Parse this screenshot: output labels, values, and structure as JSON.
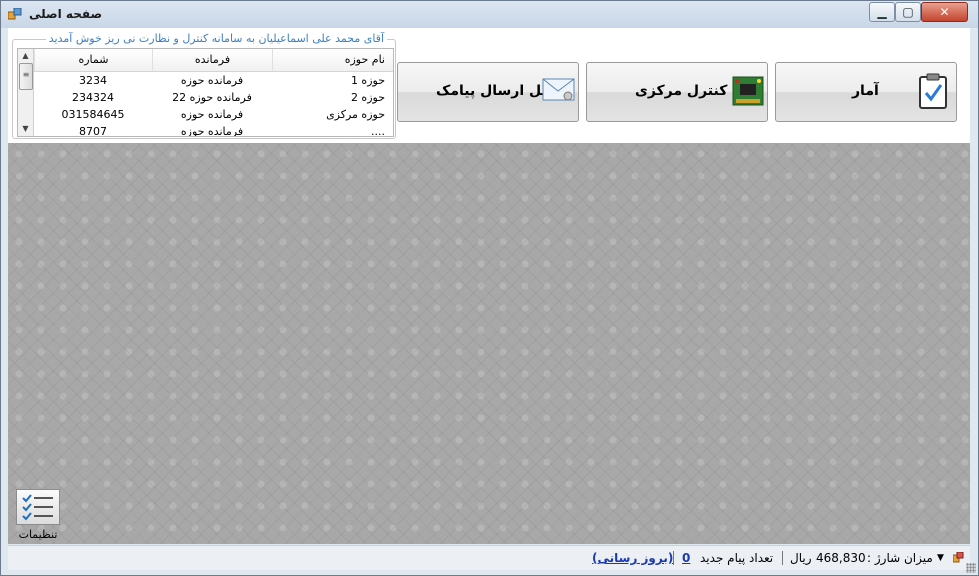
{
  "window": {
    "title": "صفحه اصلی",
    "min_symbol": "▁",
    "max_symbol": "▢",
    "close_symbol": "✕"
  },
  "group": {
    "legend": "آقای محمد علی اسماعیلیان به سامانه کنترل و نظارت نی ریز خوش آمدید"
  },
  "grid": {
    "headers": [
      "شماره",
      "فرمانده",
      "نام حوزه"
    ],
    "rows": [
      [
        "3234",
        "فرمانده حوزه",
        "حوزه 1"
      ],
      [
        "234324",
        "فرمانده حوزه 22",
        "حوزه 2"
      ],
      [
        "031584645",
        "فرمانده حوزه",
        "حوزه مرکزی"
      ],
      [
        "8707",
        "فرمانده حوزه",
        "...."
      ]
    ]
  },
  "buttons": {
    "sms": "پنل ارسال پیامک",
    "control": "کنترل مرکزی",
    "stats": "آمار"
  },
  "settings": {
    "label": "تنظیمات"
  },
  "status": {
    "charge_label": "میزان شارژ :",
    "charge_value": "468,830",
    "currency": "ریال",
    "new_messages_label": "تعداد پیام جدید",
    "new_messages_count": "0",
    "refresh_link": "(بروز رسانی)"
  },
  "icons": [
    "app-icon",
    "clipboard-check-icon",
    "circuit-board-icon",
    "envelope-icon",
    "checklist-icon",
    "dropdown-arrow-icon",
    "status-app-icon"
  ]
}
